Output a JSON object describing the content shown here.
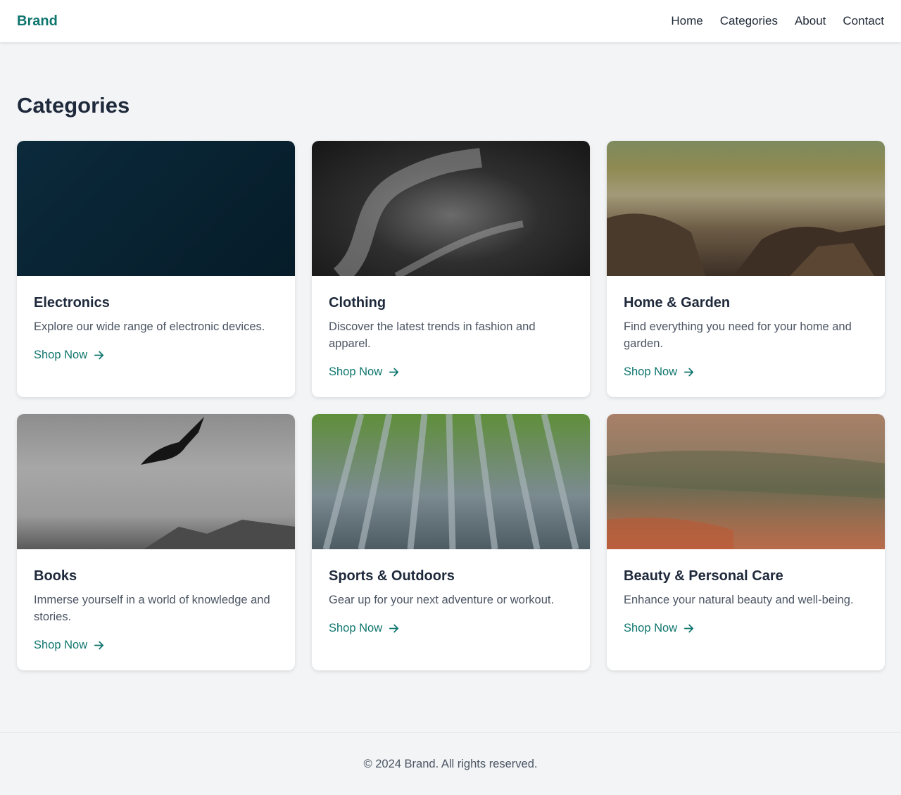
{
  "nav": {
    "brand": "Brand",
    "links": [
      "Home",
      "Categories",
      "About",
      "Contact"
    ]
  },
  "page": {
    "title": "Categories"
  },
  "categories": [
    {
      "title": "Electronics",
      "description": "Explore our wide range of electronic devices.",
      "cta": "Shop Now"
    },
    {
      "title": "Clothing",
      "description": "Discover the latest trends in fashion and apparel.",
      "cta": "Shop Now"
    },
    {
      "title": "Home & Garden",
      "description": "Find everything you need for your home and garden.",
      "cta": "Shop Now"
    },
    {
      "title": "Books",
      "description": "Immerse yourself in a world of knowledge and stories.",
      "cta": "Shop Now"
    },
    {
      "title": "Sports & Outdoors",
      "description": "Gear up for your next adventure or workout.",
      "cta": "Shop Now"
    },
    {
      "title": "Beauty & Personal Care",
      "description": "Enhance your natural beauty and well-being.",
      "cta": "Shop Now"
    }
  ],
  "footer": {
    "text": "© 2024 Brand. All rights reserved."
  },
  "colors": {
    "accent": "#0f766e",
    "background": "#f2f4f6",
    "heading": "#1e293b"
  }
}
